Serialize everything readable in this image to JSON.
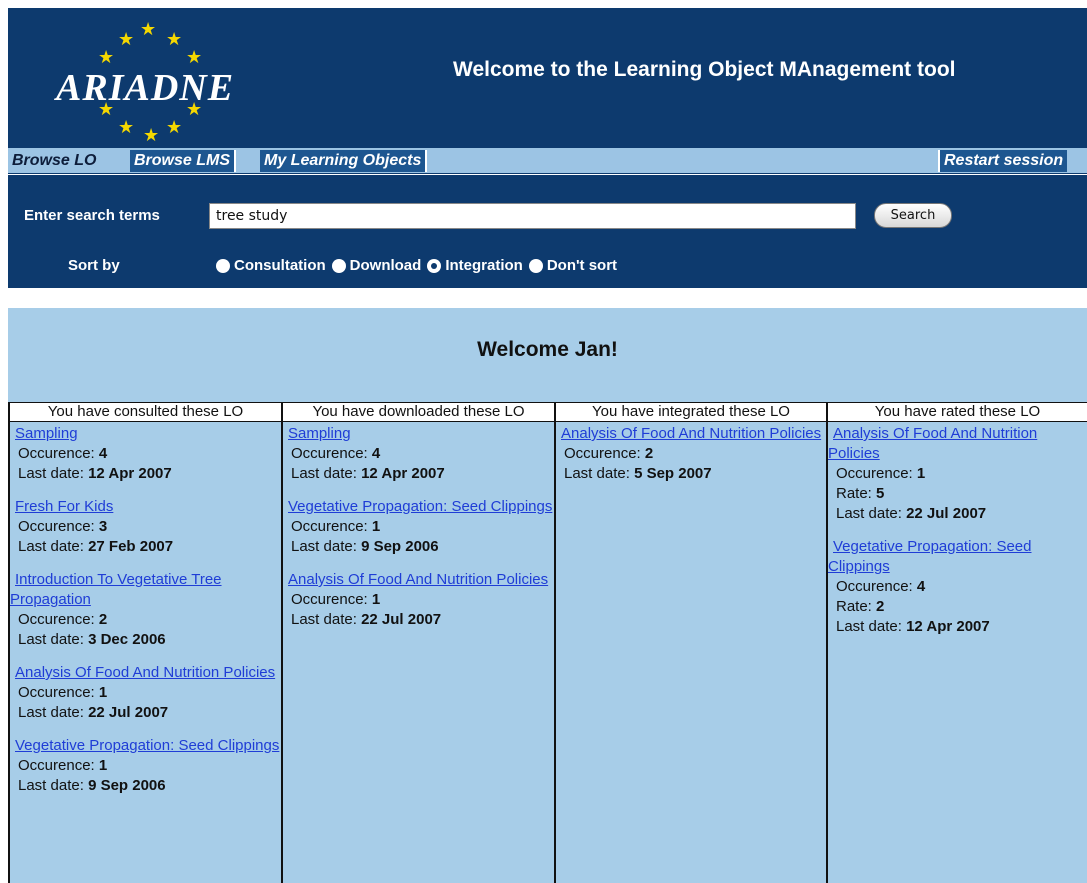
{
  "header": {
    "logo_text": "ARIADNE",
    "title": "Welcome to the Learning Object MAnagement tool"
  },
  "tabs": [
    {
      "label": "Browse LO",
      "active": true
    },
    {
      "label": "Browse LMS",
      "active": false
    },
    {
      "label": "My Learning Objects",
      "active": false
    }
  ],
  "restart_label": "Restart session",
  "search": {
    "label": "Enter search terms",
    "value": "tree study",
    "button": "Search"
  },
  "sort": {
    "label": "Sort by",
    "options": [
      "Consultation",
      "Download",
      "Integration",
      "Don't sort"
    ],
    "selected": "Integration"
  },
  "welcome": "Welcome Jan!",
  "columns": [
    {
      "header": "You have consulted these LO",
      "entries": [
        {
          "title": "Sampling",
          "occurence": "4",
          "last_date": "12 Apr 2007"
        },
        {
          "title": "Fresh For Kids",
          "occurence": "3",
          "last_date": "27 Feb 2007"
        },
        {
          "title": "Introduction To Vegetative Tree Propagation",
          "occurence": "2",
          "last_date": "3 Dec 2006"
        },
        {
          "title": "Analysis Of Food And Nutrition Policies",
          "occurence": "1",
          "last_date": "22 Jul 2007"
        },
        {
          "title": "Vegetative Propagation: Seed Clippings",
          "occurence": "1",
          "last_date": "9 Sep 2006"
        }
      ]
    },
    {
      "header": "You have downloaded these LO",
      "entries": [
        {
          "title": "Sampling",
          "occurence": "4",
          "last_date": "12 Apr 2007"
        },
        {
          "title": "Vegetative Propagation: Seed Clippings",
          "occurence": "1",
          "last_date": "9 Sep 2006"
        },
        {
          "title": "Analysis Of Food And Nutrition Policies",
          "occurence": "1",
          "last_date": "22 Jul 2007"
        }
      ]
    },
    {
      "header": "You have integrated these LO",
      "entries": [
        {
          "title": "Analysis Of Food And Nutrition Policies",
          "occurence": "2",
          "last_date": "5 Sep 2007"
        }
      ]
    },
    {
      "header": "You have rated these LO",
      "entries": [
        {
          "title": "Analysis Of Food And Nutrition Policies",
          "occurence": "1",
          "rate": "5",
          "last_date": "22 Jul 2007"
        },
        {
          "title": "Vegetative Propagation: Seed Clippings",
          "occurence": "4",
          "rate": "2",
          "last_date": "12 Apr 2007"
        }
      ]
    }
  ],
  "field_labels": {
    "occurence": "Occurence: ",
    "rate": "Rate: ",
    "last_date": "Last date: "
  },
  "colors": {
    "header_bg": "#0d3a6e",
    "tab_bg": "#1d5690",
    "content_bg": "#a7cde8",
    "link": "#1f3dd6",
    "star": "#f5d800"
  }
}
